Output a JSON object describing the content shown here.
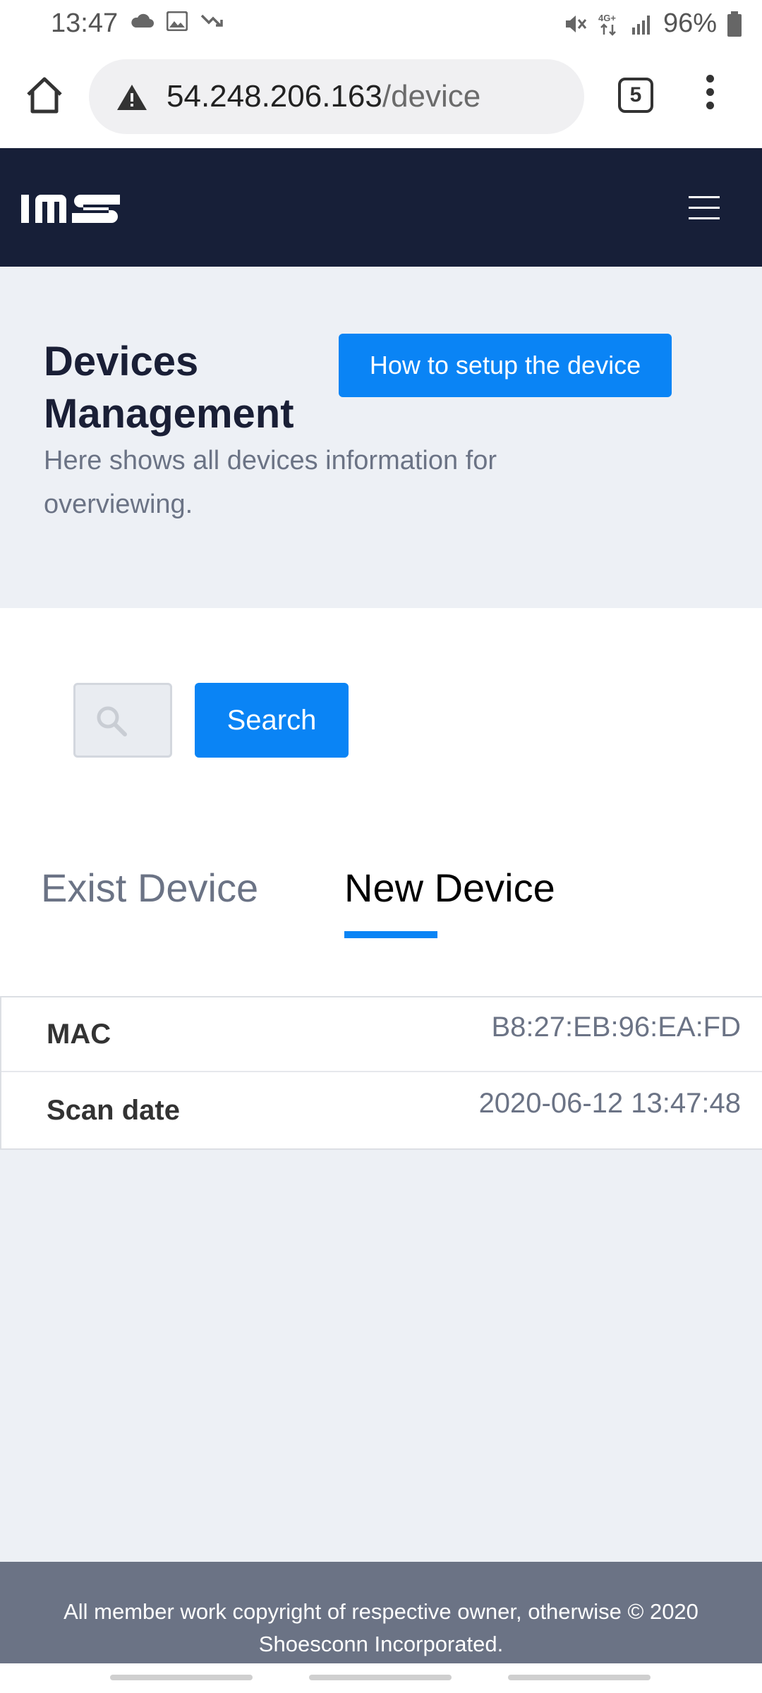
{
  "status_bar": {
    "time": "13:47",
    "left_icons": [
      "cloud-icon",
      "image-icon",
      "missed-call-icon"
    ],
    "right_icons": [
      "mute-icon",
      "network-4g-icon",
      "signal-icon",
      "battery-icon"
    ],
    "battery": "96%"
  },
  "browser": {
    "url_host": "54.248.206.163",
    "url_path": "/device",
    "tab_count": "5"
  },
  "navbar": {
    "logo": "IMS"
  },
  "header": {
    "title_line1": "Devices",
    "title_line2": "Management",
    "setup_button": "How to setup the device",
    "subtitle": "Here shows all devices information for overviewing."
  },
  "search": {
    "input_value": "",
    "button_label": "Search"
  },
  "tabs": [
    {
      "label": "Exist Device",
      "active": false
    },
    {
      "label": "New Device",
      "active": true
    }
  ],
  "device_table": [
    {
      "label": "MAC",
      "value": "B8:27:EB:96:EA:FD"
    },
    {
      "label": "Scan date",
      "value": "2020-06-12 13:47:48"
    }
  ],
  "footer": {
    "text": "All member work copyright of respective owner, otherwise © 2020 Shoesconn Incorporated."
  },
  "colors": {
    "navbar_bg": "#171f38",
    "primary": "#0a84f5",
    "page_bg": "#edf0f5",
    "footer_bg": "#6b7385"
  }
}
